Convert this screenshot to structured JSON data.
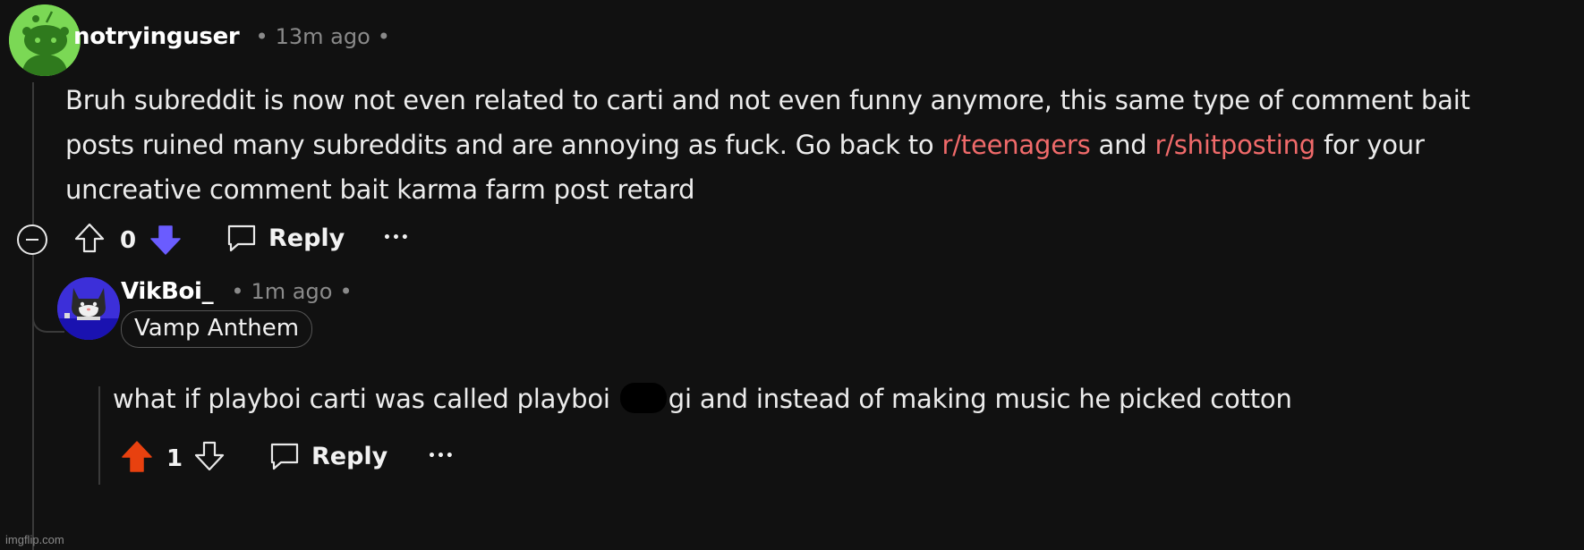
{
  "comment": {
    "username": "notryinguser",
    "separator_1": "•",
    "timestamp": "13m ago",
    "separator_2": "•",
    "body": {
      "line1": "Bruh subreddit is now not even related to carti and not even funny anymore, this same type of comment bait",
      "line2_prefix": "posts ruined many subreddits and are annoying as fuck. Go back to ",
      "link1": "r/teenagers",
      "line2_mid": " and ",
      "link2": "r/shitposting",
      "line2_suffix": " for your",
      "line3": "uncreative comment bait karma farm post retard"
    },
    "vote_count": "0",
    "reply_label": "Reply",
    "more_label": "•••",
    "downvote_color": "#6a5cff"
  },
  "reply": {
    "username": "VikBoi_",
    "separator_1": "•",
    "timestamp": "1m ago",
    "separator_2": "•",
    "flair": "Vamp Anthem",
    "body_prefix": "what if playboi carti was called playboi ",
    "body_suffix": "gi and instead of making music he picked cotton",
    "vote_count": "1",
    "reply_label": "Reply",
    "more_label": "•••",
    "upvote_color": "#e8410f"
  },
  "watermark": "imgflip.com"
}
